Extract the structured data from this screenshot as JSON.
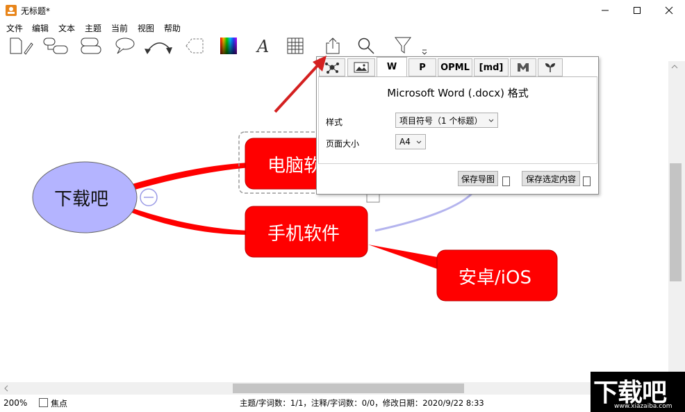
{
  "window": {
    "title": "无标题*",
    "accent": "#e8851a"
  },
  "menu": [
    "文件",
    "编辑",
    "文本",
    "主题",
    "当前",
    "视图",
    "帮助"
  ],
  "toolbar": {
    "tools": [
      "new-document-icon",
      "subtopic-icon",
      "sibling-topic-icon",
      "callout-icon",
      "relationship-icon",
      "boundary-icon",
      "color-palette-icon",
      "font-icon",
      "table-icon",
      "export-icon",
      "search-icon",
      "filter-icon"
    ]
  },
  "mindmap": {
    "root": "下载吧",
    "nodes": [
      "电脑软",
      "手机软件",
      "安卓/iOS"
    ],
    "colors": {
      "root_fill": "#b4b4ff",
      "node_fill": "#ff0000",
      "branch": "#ff0000",
      "relation": "#b4b4ee"
    }
  },
  "export_popup": {
    "tabs": [
      "",
      "",
      "W",
      "P",
      "OPML",
      "[md]",
      "",
      ""
    ],
    "tab_icons": [
      "mindmap-tab-icon",
      "image-tab-icon",
      "",
      "",
      "",
      "",
      "markdown-m-tab-icon",
      "sprout-tab-icon"
    ],
    "heading": "Microsoft Word (.docx) 格式",
    "style_label": "样式",
    "style_value": "项目符号（1 个标题）",
    "page_size_label": "页面大小",
    "page_size_value": "A4",
    "save_map_button": "保存导图",
    "save_selection_button": "保存选定内容"
  },
  "status": {
    "zoom": "200%",
    "focus_label": "焦点",
    "info": "主题/字词数：1/1，注释/字词数：0/0，修改日期：2020/9/22 8:33"
  },
  "watermark": {
    "text": "下载吧",
    "url": "www.xiazaiba.com"
  }
}
